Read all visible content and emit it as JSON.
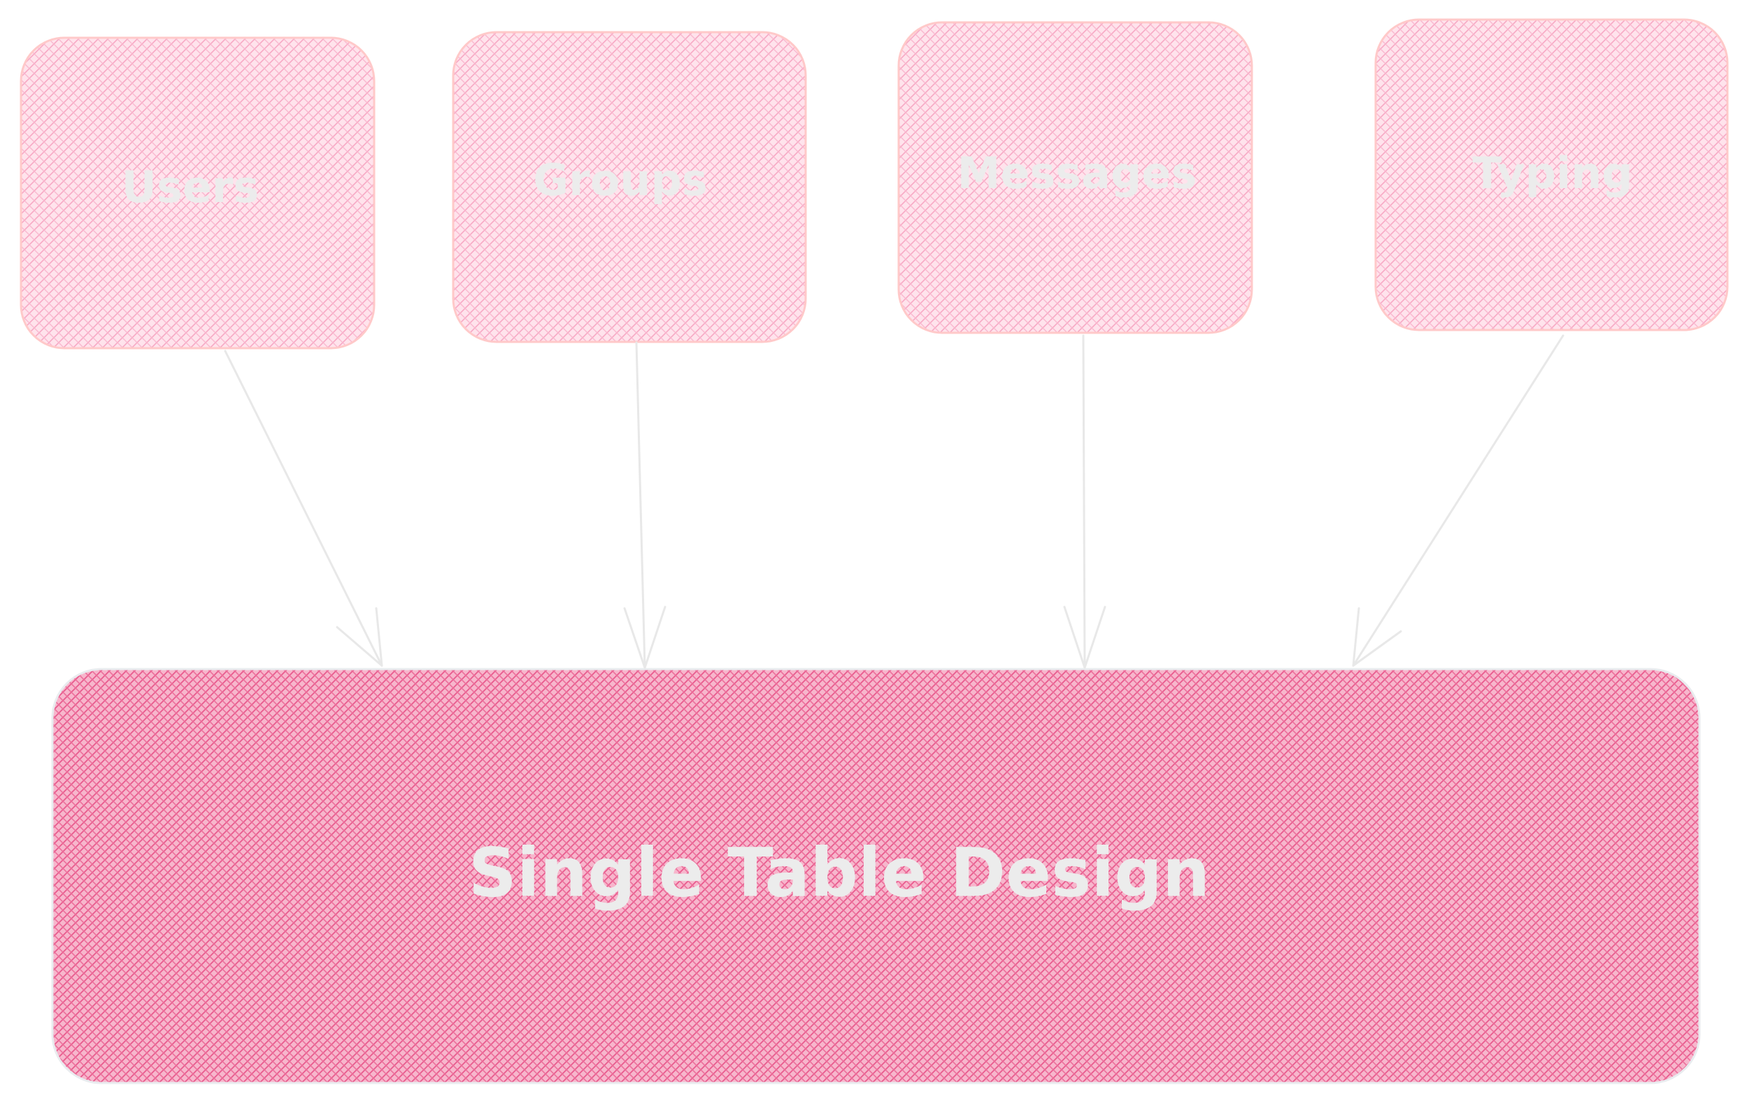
{
  "diagram": {
    "sources": [
      {
        "id": "users",
        "label": "Users"
      },
      {
        "id": "groups",
        "label": "Groups"
      },
      {
        "id": "messages",
        "label": "Messages"
      },
      {
        "id": "typing",
        "label": "Typing"
      }
    ],
    "target": {
      "id": "single-table",
      "label": "Single Table Design"
    },
    "edges": [
      {
        "from": "users",
        "to": "single-table"
      },
      {
        "from": "groups",
        "to": "single-table"
      },
      {
        "from": "messages",
        "to": "single-table"
      },
      {
        "from": "typing",
        "to": "single-table"
      }
    ],
    "colors": {
      "source_fill": "#ffc9d9",
      "source_hatch": "#f8a5c2",
      "source_stroke": "#ffc9c9",
      "target_fill": "#f783ac",
      "target_hatch": "#e64980",
      "target_stroke": "#e9ecef",
      "arrow": "#e8e8e8",
      "text": "#ececec"
    }
  }
}
